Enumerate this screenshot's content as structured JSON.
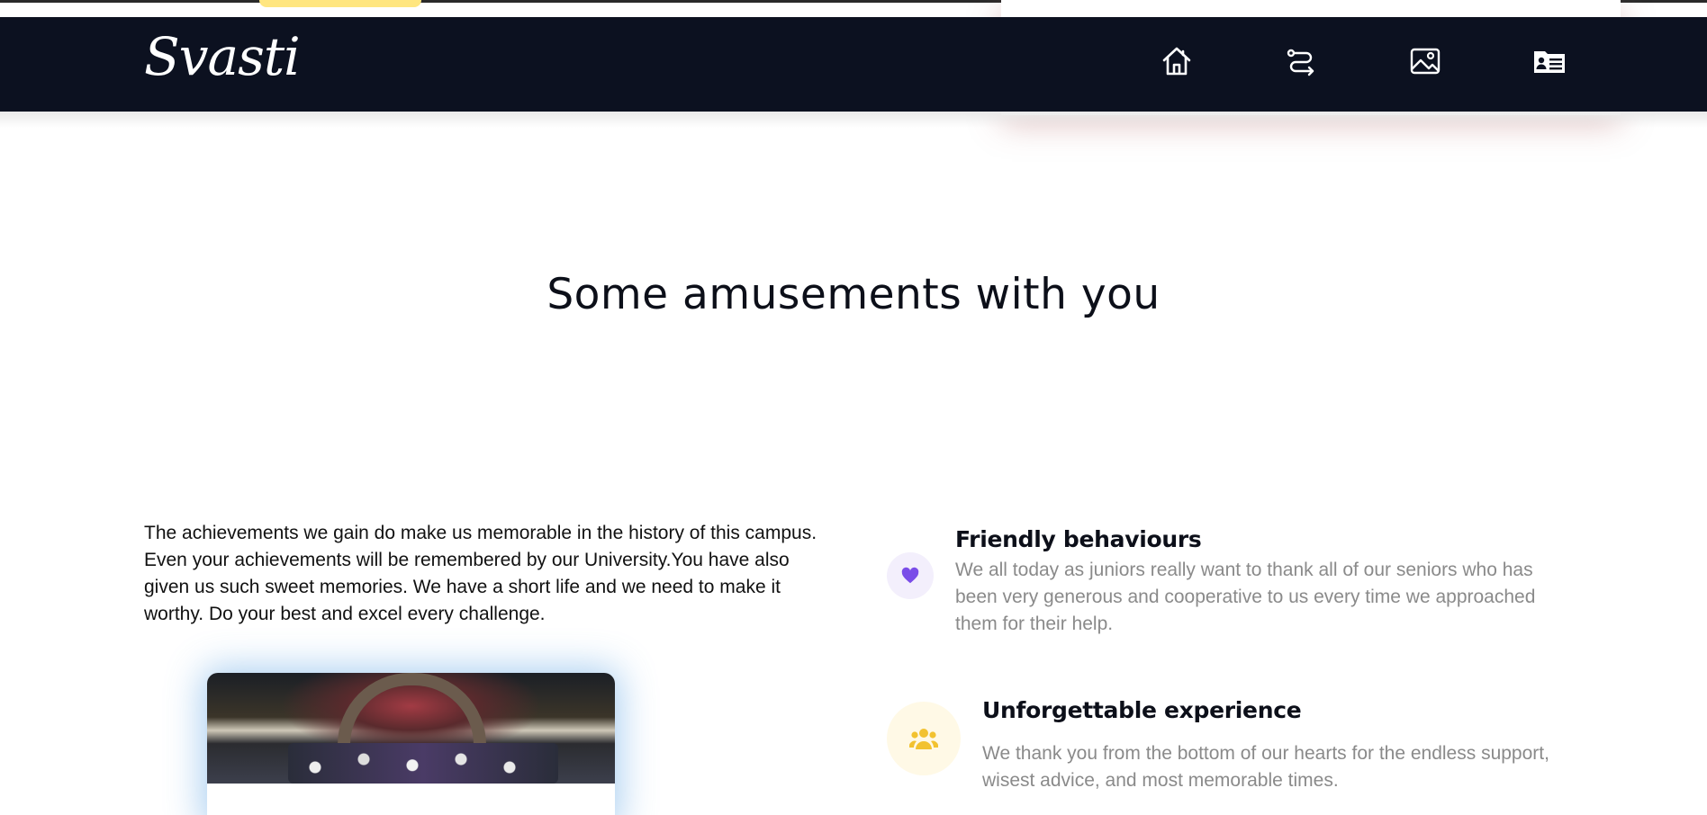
{
  "brand": {
    "logo_text": "Svasti"
  },
  "nav": {
    "items": [
      {
        "icon": "home-icon"
      },
      {
        "icon": "route-icon"
      },
      {
        "icon": "image-icon"
      },
      {
        "icon": "contact-card-icon"
      }
    ]
  },
  "section": {
    "title": "Some amusements with you"
  },
  "intro": {
    "text": "The achievements we gain do make us memorable in the history of this campus. Even your achievements will be remembered by our University.You have also given us such sweet memories. We have a short life and we need to make it worthy. Do your best and excel every challenge."
  },
  "features": [
    {
      "icon": "heart-icon",
      "accent": "#7a4de8",
      "icon_bg": "#f3effc",
      "title": "Friendly behaviours",
      "text": "We all today as juniors really want to thank all of our seniors who has been very generous and cooperative to us every time we approached them for their help."
    },
    {
      "icon": "group-icon",
      "accent": "#f2c230",
      "icon_bg": "#fff9e6",
      "title": "Unforgettable experience",
      "text": "We thank you from the bottom of our hearts for the endless support, wisest advice, and most memorable times."
    }
  ],
  "colors": {
    "navbar_bg": "#0c1120",
    "heading": "#0c0f19",
    "muted_text": "#8a8a8a",
    "photo_glow": "#4696e1"
  }
}
